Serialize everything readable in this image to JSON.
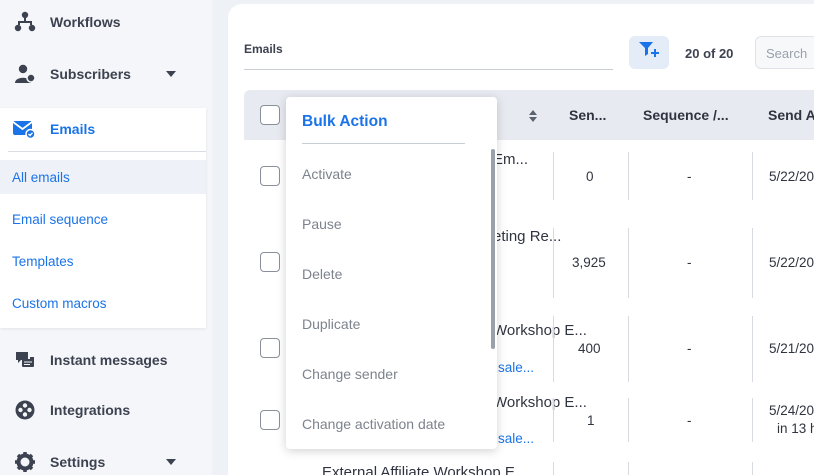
{
  "sidebar": {
    "workflows": "Workflows",
    "subscribers": "Subscribers",
    "emails": "Emails",
    "email_items": [
      "All emails",
      "Email sequence",
      "Templates",
      "Custom macros"
    ],
    "instant_messages": "Instant messages",
    "integrations": "Integrations",
    "settings": "Settings"
  },
  "toolbar": {
    "title": "Emails",
    "count": "20 of 20",
    "search_placeholder": "Search"
  },
  "table": {
    "headers": [
      "Sen...",
      "Sequence /...",
      "Send A"
    ],
    "rows": [
      {
        "name": "Em...",
        "sub": "",
        "sent": "0",
        "sequence": "-",
        "date": "5/22/20",
        "date2": ""
      },
      {
        "name": "eting Re...",
        "sub": "",
        "sent": "3,925",
        "sequence": "-",
        "date": "5/22/20",
        "date2": ""
      },
      {
        "name": "Workshop E...",
        "sub": "sale...",
        "sent": "400",
        "sequence": "-",
        "date": "5/21/20",
        "date2": ""
      },
      {
        "name": "Workshop E...",
        "sub": "sale...",
        "sent": "1",
        "sequence": "-",
        "date": "5/24/20",
        "date2": "in 13 h"
      },
      {
        "name": "External Affiliate Workshop E...",
        "sub": "",
        "sent": "",
        "sequence": "",
        "date": "",
        "date2": ""
      }
    ]
  },
  "bulk_action": {
    "title": "Bulk Action",
    "items": [
      "Activate",
      "Pause",
      "Delete",
      "Duplicate",
      "Change sender",
      "Change activation date"
    ]
  },
  "colors": {
    "accent": "#1a73e8",
    "sidebar_bg": "#f4f6f9",
    "header_bg": "#e7ebf1"
  }
}
